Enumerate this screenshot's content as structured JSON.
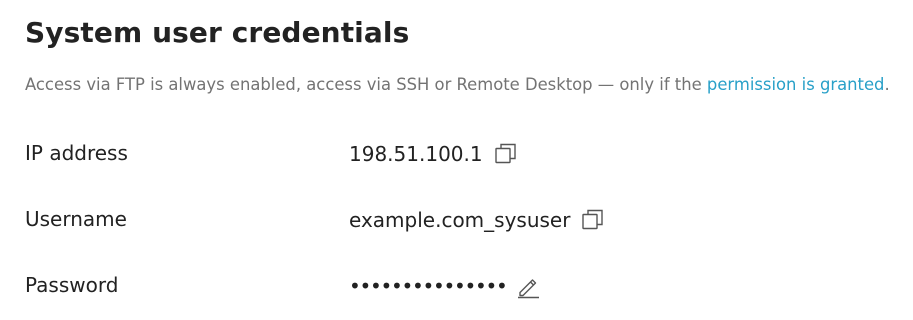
{
  "section": {
    "title": "System user credentials",
    "description_text": "Access via FTP is always enabled, access via SSH or Remote Desktop — only if the ",
    "description_link": "permission is granted",
    "description_end": "."
  },
  "fields": {
    "ip": {
      "label": "IP address",
      "value": "198.51.100.1",
      "action_icon": "copy-icon"
    },
    "username": {
      "label": "Username",
      "value": "example.com_sysuser",
      "action_icon": "copy-icon"
    },
    "password": {
      "label": "Password",
      "value": "•••••••••••••••",
      "action_icon": "edit-pencil-icon"
    }
  },
  "colors": {
    "text": "#222222",
    "muted": "#737373",
    "link": "#28a0c8",
    "icon": "#555555"
  }
}
